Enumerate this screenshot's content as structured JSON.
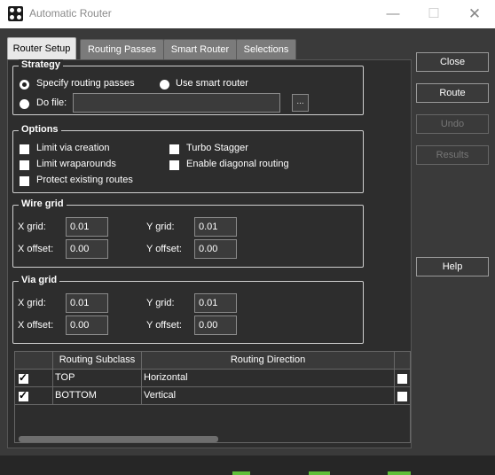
{
  "window": {
    "title": "Automatic Router"
  },
  "tabs": [
    "Router Setup",
    "Routing Passes",
    "Smart Router",
    "Selections"
  ],
  "strategy": {
    "title": "Strategy",
    "specify_label": "Specify routing passes",
    "smart_label": "Use smart router",
    "dofile_label": "Do file:",
    "dofile_value": "",
    "browse_label": "..."
  },
  "options": {
    "title": "Options",
    "limit_via": "Limit via creation",
    "limit_wrap": "Limit wraparounds",
    "protect": "Protect existing routes",
    "turbo": "Turbo Stagger",
    "diagonal": "Enable diagonal routing"
  },
  "wire_grid": {
    "title": "Wire grid",
    "xgrid_label": "X grid:",
    "xgrid_value": "0.01",
    "xoffset_label": "X offset:",
    "xoffset_value": "0.00",
    "ygrid_label": "Y grid:",
    "ygrid_value": "0.01",
    "yoffset_label": "Y offset:",
    "yoffset_value": "0.00"
  },
  "via_grid": {
    "title": "Via grid",
    "xgrid_label": "X grid:",
    "xgrid_value": "0.01",
    "xoffset_label": "X offset:",
    "xoffset_value": "0.00",
    "ygrid_label": "Y grid:",
    "ygrid_value": "0.01",
    "yoffset_label": "Y offset:",
    "yoffset_value": "0.00"
  },
  "table": {
    "headers": [
      "Routing Subclass",
      "Routing Direction"
    ],
    "rows": [
      {
        "subclass": "TOP",
        "direction": "Horizontal",
        "checked": true
      },
      {
        "subclass": "BOTTOM",
        "direction": "Vertical",
        "checked": true
      }
    ]
  },
  "buttons": {
    "close": "Close",
    "route": "Route",
    "undo": "Undo",
    "results": "Results",
    "help": "Help"
  }
}
